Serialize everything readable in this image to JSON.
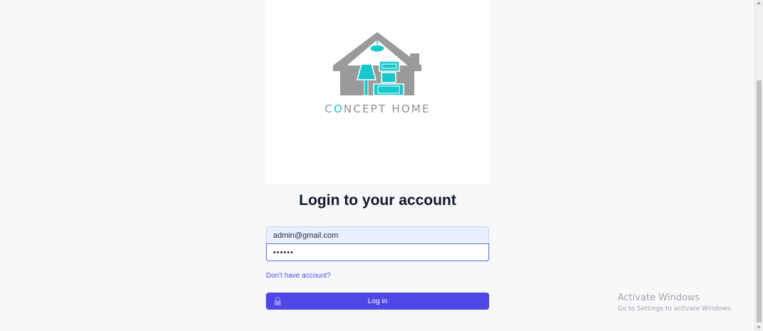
{
  "brand": {
    "logo_icon": "house-logo-icon",
    "name_first": "C",
    "name_accent": "O",
    "name_rest": "NCEPT HOME",
    "accent_color": "#14c8cc",
    "house_color": "#9a9a9a"
  },
  "login": {
    "title": "Login to your account",
    "email_value": "admin@gmail.com",
    "password_value": "••••••",
    "signup_link": "Don't have account?",
    "submit_label": "Log in",
    "submit_icon": "lock-icon",
    "button_color": "#4f46e5"
  },
  "watermark": {
    "title": "Activate Windows",
    "subtitle": "Go to Settings to activate Windows."
  }
}
